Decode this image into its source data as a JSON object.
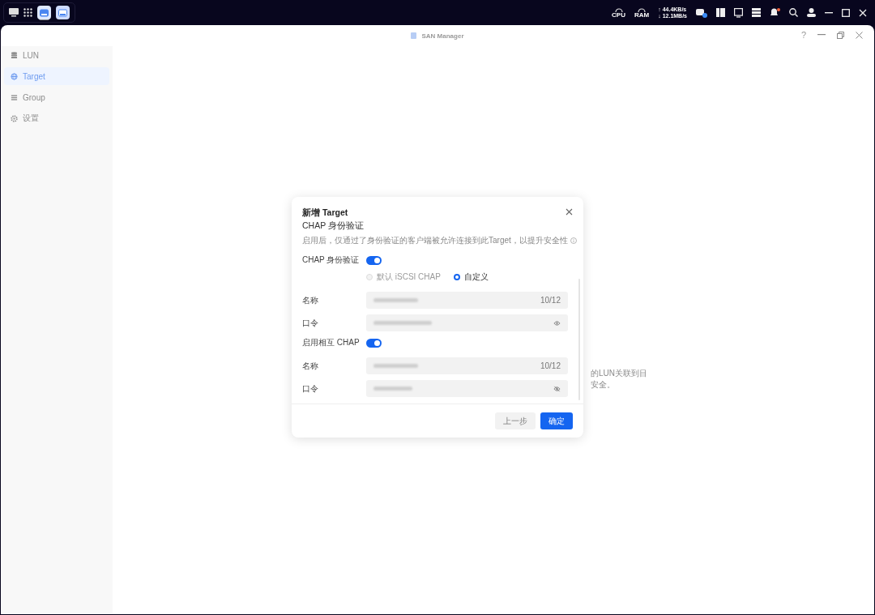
{
  "taskbar": {
    "apps": [
      {
        "kind": "desktop"
      },
      {
        "kind": "grid"
      },
      {
        "kind": "app",
        "selected": true
      },
      {
        "kind": "app",
        "selected": false
      }
    ],
    "net": {
      "up": "↑ 44.4KB/s",
      "down": "↓ 12.1MB/s"
    },
    "meters": [
      "CPU",
      "RAM"
    ],
    "notification": true
  },
  "window": {
    "title": "SAN Manager",
    "help": "?"
  },
  "sidebar": {
    "items": [
      {
        "label": "LUN",
        "kind": "database",
        "selected": false
      },
      {
        "label": "Target",
        "kind": "globe",
        "selected": true
      },
      {
        "label": "Group",
        "kind": "list",
        "selected": false
      },
      {
        "label": "设置",
        "kind": "gear",
        "selected": false
      }
    ]
  },
  "background_text": [
    "的LUN关联到目",
    "安全。"
  ],
  "dialog": {
    "title": "新增 Target",
    "subtitle": "CHAP 身份验证",
    "description": "启用后，仅通过了身份验证的客户端被允许连接到此Target，以提升安全性",
    "rows": [
      {
        "kind": "toggle",
        "label": "CHAP 身份验证",
        "on": true
      },
      {
        "kind": "radio",
        "options": [
          {
            "label": "默认 iSCSI CHAP",
            "selected": false,
            "disabled": true
          },
          {
            "label": "自定义",
            "selected": true,
            "disabled": false
          }
        ]
      },
      {
        "kind": "field",
        "label": "名称",
        "counter": "10/12"
      },
      {
        "kind": "password",
        "label": "口令",
        "revealed": true
      },
      {
        "kind": "toggle",
        "label": "启用相互 CHAP",
        "on": true
      },
      {
        "kind": "field",
        "label": "名称",
        "counter": "10/12"
      },
      {
        "kind": "password",
        "label": "口令",
        "revealed": false
      }
    ],
    "buttons": [
      {
        "label": "上一步",
        "primary": false
      },
      {
        "label": "确定",
        "primary": true
      }
    ]
  }
}
